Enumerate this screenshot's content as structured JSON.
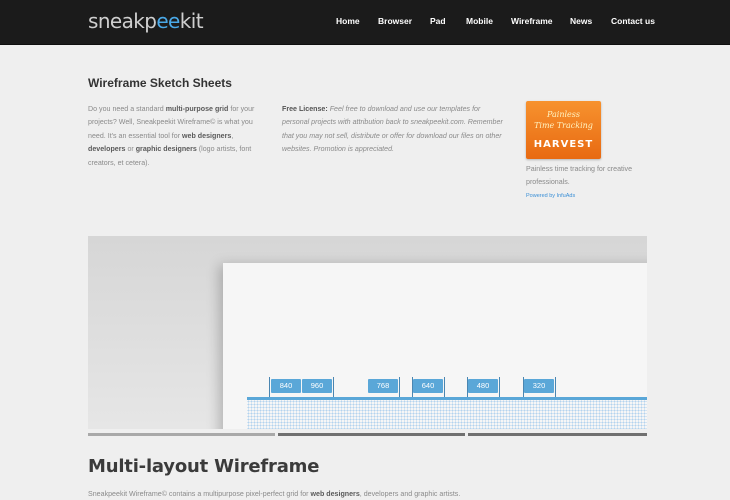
{
  "header": {
    "logo": {
      "part1": "sneakp",
      "part2": "ee",
      "part3": "kit"
    },
    "nav": [
      "Home",
      "Browser",
      "Pad",
      "Mobile",
      "Wireframe",
      "News",
      "Contact us"
    ]
  },
  "intro": {
    "title": "Wireframe Sketch Sheets",
    "col1": {
      "t1": "Do you need a standard ",
      "b1": "multi-purpose grid",
      "t2": " for your projects? Well, Sneakpeekit Wireframe© is what you need. It's an essential tool for ",
      "b2": "web designers",
      "t3": ", ",
      "b3": "developers",
      "t4": " or ",
      "b4": "graphic designers",
      "t5": " (logo artists, font creators, et cetera)."
    },
    "col2": {
      "label": "Free License:",
      "text": " Feel free to download and use our templates for personal projects with attribution back to sneakpeekit.com. Remember that you may not sell, distribute or offer for download our files on other websites. Promotion is appreciated."
    }
  },
  "ad": {
    "tagline_line1": "Painless",
    "tagline_line2": "Time Tracking",
    "brand": "HARVEST",
    "text": "Painless time tracking for creative professionals.",
    "powered": "Powered by InfuAds"
  },
  "hero": {
    "breakpoints": [
      "840",
      "960",
      "768",
      "640",
      "480",
      "320"
    ],
    "active_slide": 1
  },
  "section2": {
    "title": "Multi-layout Wireframe",
    "t1": "Sneakpeekit Wireframe© contains a multipurpose pixel-perfect grid for ",
    "b1": "web designers",
    "t2": ", developers and graphic artists."
  },
  "colors": {
    "header_bg": "#1b1b1b",
    "accent_blue": "#4aa9e8",
    "ad_orange": "#f7922e",
    "breakpoint_blue": "#5aa7d8"
  }
}
